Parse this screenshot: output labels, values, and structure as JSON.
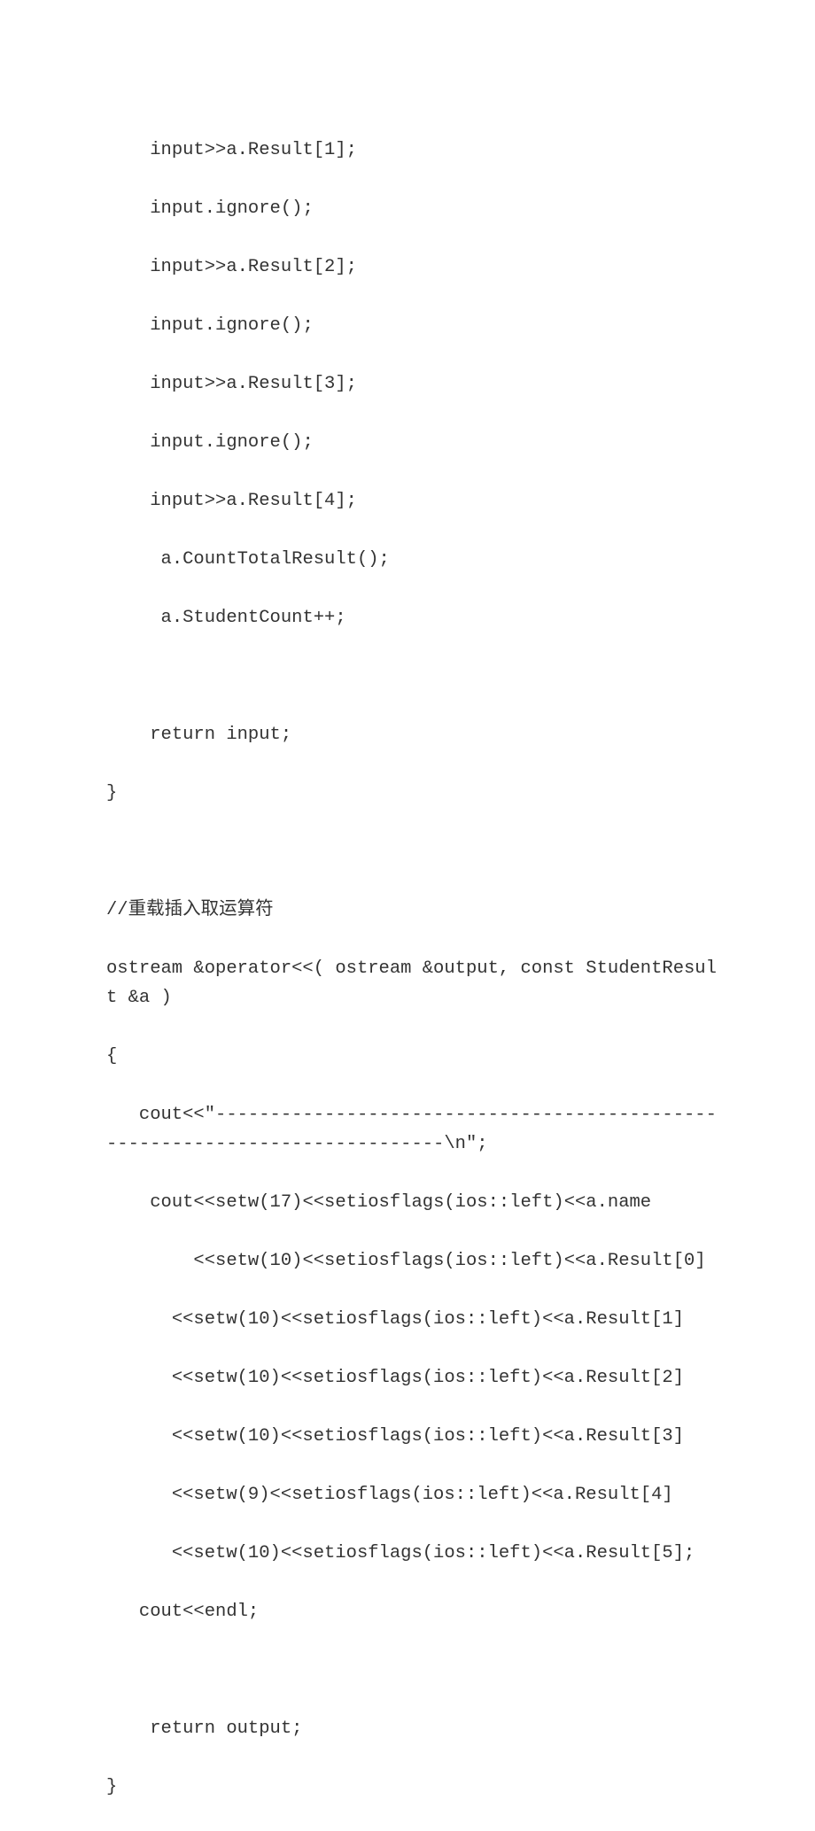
{
  "lines": {
    "l1": "    input>>a.Result[1];",
    "l2": "    input.ignore();",
    "l3": "    input>>a.Result[2];",
    "l4": "    input.ignore();",
    "l5": "    input>>a.Result[3];",
    "l6": "    input.ignore();",
    "l7": "    input>>a.Result[4];",
    "l8": "     a.CountTotalResult();",
    "l9": "     a.StudentCount++;",
    "l10": "",
    "l11": "    return input;",
    "l12": "}",
    "l13": "",
    "l14": "//重载插入取运算符",
    "l15": "ostream &operator<<( ostream &output, const StudentResult &a )",
    "l16": "{",
    "l17": "   cout<<\"-----------------------------------------------------------------------------\\n\";",
    "l18": "    cout<<setw(17)<<setiosflags(ios::left)<<a.name",
    "l19": "        <<setw(10)<<setiosflags(ios::left)<<a.Result[0]",
    "l20": "      <<setw(10)<<setiosflags(ios::left)<<a.Result[1]",
    "l21": "      <<setw(10)<<setiosflags(ios::left)<<a.Result[2]",
    "l22": "      <<setw(10)<<setiosflags(ios::left)<<a.Result[3]",
    "l23": "      <<setw(9)<<setiosflags(ios::left)<<a.Result[4]",
    "l24": "      <<setw(10)<<setiosflags(ios::left)<<a.Result[5];",
    "l25": "   cout<<endl;",
    "l26": "",
    "l27": "    return output;",
    "l28": "}"
  }
}
